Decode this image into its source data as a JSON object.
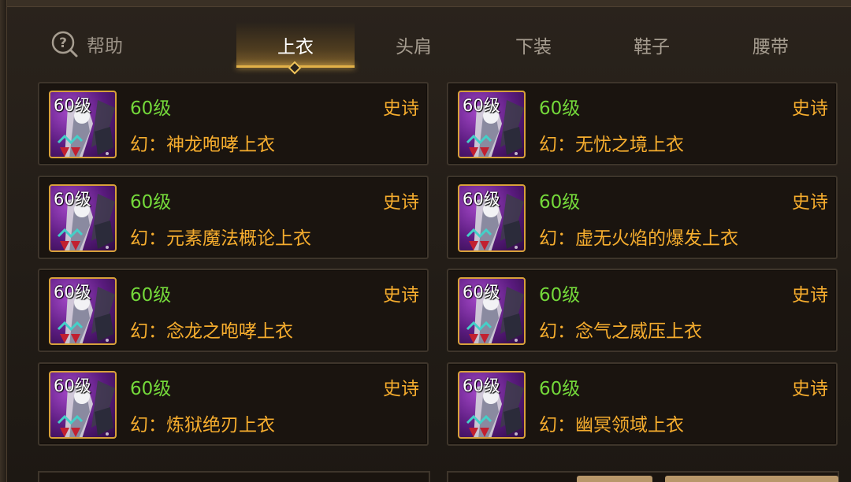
{
  "help": {
    "label": "帮助",
    "icon": "help-icon"
  },
  "tabs": [
    {
      "label": "上衣",
      "active": true
    },
    {
      "label": "头肩",
      "active": false
    },
    {
      "label": "下装",
      "active": false
    },
    {
      "label": "鞋子",
      "active": false
    },
    {
      "label": "腰带",
      "active": false
    }
  ],
  "colors": {
    "level": "#74d83a",
    "rarity": "#f6ad2e",
    "name": "#f6ad2e",
    "accent": "#e2b148"
  },
  "items": [
    {
      "thumb_level": "60级",
      "level": "60级",
      "rarity": "史诗",
      "name": "幻：神龙咆哮上衣"
    },
    {
      "thumb_level": "60级",
      "level": "60级",
      "rarity": "史诗",
      "name": "幻：无忧之境上衣"
    },
    {
      "thumb_level": "60级",
      "level": "60级",
      "rarity": "史诗",
      "name": "幻：元素魔法概论上衣"
    },
    {
      "thumb_level": "60级",
      "level": "60级",
      "rarity": "史诗",
      "name": "幻：虚无火焰的爆发上衣"
    },
    {
      "thumb_level": "60级",
      "level": "60级",
      "rarity": "史诗",
      "name": "幻：念龙之咆哮上衣"
    },
    {
      "thumb_level": "60级",
      "level": "60级",
      "rarity": "史诗",
      "name": "幻：念气之威压上衣"
    },
    {
      "thumb_level": "60级",
      "level": "60级",
      "rarity": "史诗",
      "name": "幻：炼狱绝刃上衣"
    },
    {
      "thumb_level": "60级",
      "level": "60级",
      "rarity": "史诗",
      "name": "幻：幽冥领域上衣"
    }
  ]
}
